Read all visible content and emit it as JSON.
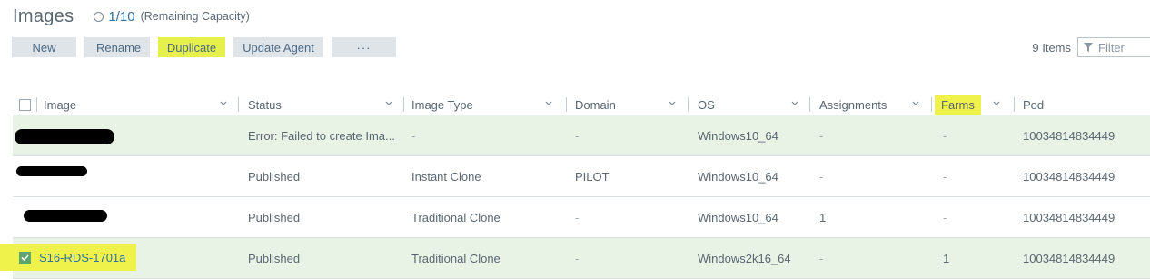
{
  "header": {
    "title": "Images",
    "capacity_value": "1/10",
    "capacity_label": "(Remaining Capacity)"
  },
  "toolbar": {
    "new_label": "New",
    "rename_label": "Rename",
    "duplicate_label": "Duplicate",
    "update_agent_label": "Update Agent",
    "more_label": "···"
  },
  "items_count": "9 Items",
  "filter": {
    "placeholder": "Filter"
  },
  "highlight_color": "#eef24a",
  "columns": [
    "Image",
    "Status",
    "Image Type",
    "Domain",
    "OS",
    "Assignments",
    "Farms",
    "Pod"
  ],
  "rows": [
    {
      "image": "",
      "status": "Error: Failed to create Ima...",
      "type": "-",
      "domain": "-",
      "os": "Windows10_64",
      "assignments": "-",
      "farms": "-",
      "pod": "10034814834449",
      "checked": false
    },
    {
      "image": "",
      "status": "Published",
      "type": "Instant Clone",
      "domain": "PILOT",
      "os": "Windows10_64",
      "assignments": "-",
      "farms": "-",
      "pod": "10034814834449",
      "checked": false
    },
    {
      "image": "",
      "status": "Published",
      "type": "Traditional Clone",
      "domain": "-",
      "os": "Windows10_64",
      "assignments": "1",
      "farms": "-",
      "pod": "10034814834449",
      "checked": false
    },
    {
      "image": "S16-RDS-1701a",
      "status": "Published",
      "type": "Traditional Clone",
      "domain": "-",
      "os": "Windows2k16_64",
      "assignments": "-",
      "farms": "1",
      "pod": "10034814834449",
      "checked": true
    }
  ]
}
